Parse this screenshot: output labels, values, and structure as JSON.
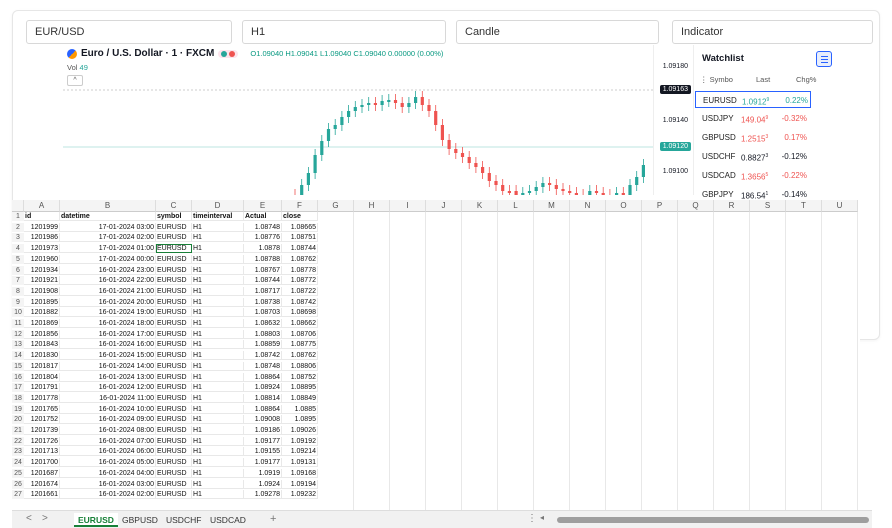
{
  "fields": {
    "symbol": "EUR/USD",
    "timeframe": "H1",
    "chart_type": "Candle",
    "indicator": "Indicator"
  },
  "chart": {
    "title": "Euro / U.S. Dollar · 1 · FXCM",
    "ohlc": "O1.09040 H1.09041 L1.09040 C1.09040 0.00000 (0.00%)",
    "vol_label": "Vol",
    "vol_value": "49",
    "collapse": "^",
    "price_labels": [
      "1.09180",
      "1.09140",
      "1.09100"
    ],
    "tags": [
      {
        "text": "1.09163",
        "color": "#131722"
      },
      {
        "text": "1.09120",
        "color": "#26a69a"
      }
    ],
    "colors": {
      "up": "#26a69a",
      "down": "#ef5350"
    }
  },
  "watchlist": {
    "title": "Watchlist",
    "columns": [
      "Symbo",
      "Last",
      "Chg%"
    ],
    "rows": [
      {
        "symbol": "EURUSD",
        "last": "1.0912",
        "sup": "9",
        "chg": "0.22%",
        "dir": "up"
      },
      {
        "symbol": "USDJPY",
        "last": "149.04",
        "sup": "9",
        "chg": "-0.32%",
        "dir": "down"
      },
      {
        "symbol": "GBPUSD",
        "last": "1.2515",
        "sup": "3",
        "chg": "0.17%",
        "dir": "down"
      },
      {
        "symbol": "USDCHF",
        "last": "0.8827",
        "sup": "3",
        "chg": "-0.12%",
        "dir": "flat"
      },
      {
        "symbol": "USDCAD",
        "last": "1.3656",
        "sup": "5",
        "chg": "-0.22%",
        "dir": "down"
      },
      {
        "symbol": "GBPJPY",
        "last": "186.54",
        "sup": "1",
        "chg": "-0.14%",
        "dir": "flat"
      }
    ],
    "colors": {
      "up": "#26a69a",
      "down": "#ef5350",
      "flat": "#131722"
    }
  },
  "sheet": {
    "columns": [
      "A",
      "B",
      "C",
      "D",
      "E",
      "F",
      "G",
      "H",
      "I",
      "J",
      "K",
      "L",
      "M",
      "N",
      "O",
      "P",
      "Q",
      "R",
      "S",
      "T",
      "U"
    ],
    "headers": [
      "id",
      "datetime",
      "symbol",
      "timeinterval",
      "Actual",
      "close"
    ],
    "rows": [
      [
        "1201999",
        "17-01-2024 03:00",
        "EURUSD",
        "H1",
        "1.08748",
        "1.08665"
      ],
      [
        "1201986",
        "17-01-2024 02:00",
        "EURUSD",
        "H1",
        "1.08776",
        "1.08751"
      ],
      [
        "1201973",
        "17-01-2024 01:00",
        "EURUSD",
        "H1",
        "1.0878",
        "1.08744"
      ],
      [
        "1201960",
        "17-01-2024 00:00",
        "EURUSD",
        "H1",
        "1.08788",
        "1.08762"
      ],
      [
        "1201934",
        "16-01-2024 23:00",
        "EURUSD",
        "H1",
        "1.08767",
        "1.08778"
      ],
      [
        "1201921",
        "16-01-2024 22:00",
        "EURUSD",
        "H1",
        "1.08744",
        "1.08772"
      ],
      [
        "1201908",
        "16-01-2024 21:00",
        "EURUSD",
        "H1",
        "1.08717",
        "1.08722"
      ],
      [
        "1201895",
        "16-01-2024 20:00",
        "EURUSD",
        "H1",
        "1.08738",
        "1.08742"
      ],
      [
        "1201882",
        "16-01-2024 19:00",
        "EURUSD",
        "H1",
        "1.08703",
        "1.08698"
      ],
      [
        "1201869",
        "16-01-2024 18:00",
        "EURUSD",
        "H1",
        "1.08632",
        "1.08662"
      ],
      [
        "1201856",
        "16-01-2024 17:00",
        "EURUSD",
        "H1",
        "1.08803",
        "1.08706"
      ],
      [
        "1201843",
        "16-01-2024 16:00",
        "EURUSD",
        "H1",
        "1.08859",
        "1.08775"
      ],
      [
        "1201830",
        "16-01-2024 15:00",
        "EURUSD",
        "H1",
        "1.08742",
        "1.08762"
      ],
      [
        "1201817",
        "16-01-2024 14:00",
        "EURUSD",
        "H1",
        "1.08748",
        "1.08806"
      ],
      [
        "1201804",
        "16-01-2024 13:00",
        "EURUSD",
        "H1",
        "1.08864",
        "1.08752"
      ],
      [
        "1201791",
        "16-01-2024 12:00",
        "EURUSD",
        "H1",
        "1.08924",
        "1.08895"
      ],
      [
        "1201778",
        "16-01-2024 11:00",
        "EURUSD",
        "H1",
        "1.08814",
        "1.08849"
      ],
      [
        "1201765",
        "16-01-2024 10:00",
        "EURUSD",
        "H1",
        "1.08864",
        "1.0885"
      ],
      [
        "1201752",
        "16-01-2024 09:00",
        "EURUSD",
        "H1",
        "1.09008",
        "1.0895"
      ],
      [
        "1201739",
        "16-01-2024 08:00",
        "EURUSD",
        "H1",
        "1.09186",
        "1.09026"
      ],
      [
        "1201726",
        "16-01-2024 07:00",
        "EURUSD",
        "H1",
        "1.09177",
        "1.09192"
      ],
      [
        "1201713",
        "16-01-2024 06:00",
        "EURUSD",
        "H1",
        "1.09155",
        "1.09214"
      ],
      [
        "1201700",
        "16-01-2024 05:00",
        "EURUSD",
        "H1",
        "1.09177",
        "1.09131"
      ],
      [
        "1201687",
        "16-01-2024 04:00",
        "EURUSD",
        "H1",
        "1.0919",
        "1.09168"
      ],
      [
        "1201674",
        "16-01-2024 03:00",
        "EURUSD",
        "H1",
        "1.0924",
        "1.09194"
      ],
      [
        "1201661",
        "16-01-2024 02:00",
        "EURUSD",
        "H1",
        "1.09278",
        "1.09232"
      ]
    ],
    "active_cell": "C4"
  },
  "tabs": {
    "items": [
      "EURUSD",
      "GBPUSD",
      "USDCHF",
      "USDCAD"
    ],
    "active": 0,
    "add": "+",
    "prev": "<",
    "next": ">",
    "more": "⋮",
    "scroll_left": "◂"
  }
}
